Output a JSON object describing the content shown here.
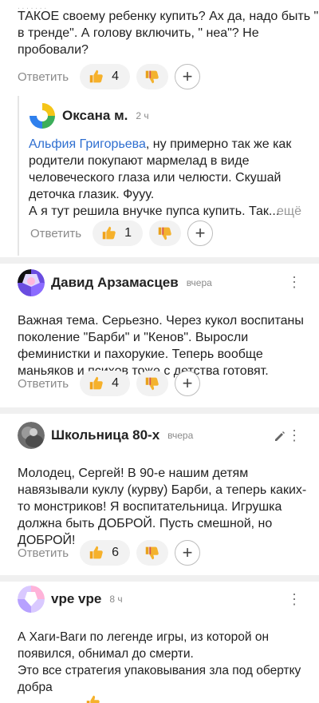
{
  "top_comment": {
    "lines": [
      "ТАКОЕ своему ребенку купить? Ах да, надо быть \"",
      "в тренде\". А голову включить, \" неа\"? Не",
      "пробовали?"
    ],
    "likes": "4"
  },
  "reply": {
    "author": "Оксана м.",
    "time": "2 ч",
    "mention": "Альфия Григорьева",
    "line1_rest": ", ну примерно так же как",
    "lines": [
      "родители покупают мармелад в виде",
      "человеческого глаза или челюсти. Скушай",
      "деточка глазик. Фууу.",
      "А я тут решила внучке пупса купить. Так..."
    ],
    "more": "ещё",
    "likes": "1"
  },
  "comment_david": {
    "author": "Давид Арзамасцев",
    "time": "вчера",
    "lines": [
      "Важная тема. Серьезно. Через кукол воспитаны",
      "поколение \"Барби\" и \"Кенов\". Выросли",
      "феминистки и пахорукие. Теперь вообще",
      "маньяков и психов тоже с детства готовят."
    ],
    "likes": "4"
  },
  "comment_school": {
    "author": "Школьница 80-х",
    "time": "вчера",
    "lines": [
      "Молодец, Сергей! В 90-е нашим детям",
      "навязывали куклу (курву) Барби, а теперь каких-",
      "то монстриков! Я воспитательница. Игрушка",
      "должна быть ДОБРОЙ. Пусть смешной, но",
      "ДОБРОЙ!"
    ],
    "likes": "6"
  },
  "comment_vpe": {
    "author": "vpe vpe",
    "time": "8 ч",
    "lines": [
      "А Хаги-Ваги по легенде игры, из которой он",
      "появился, обнимал до смерти.",
      "Это все стратегия упаковывания зла под обертку",
      "добра"
    ]
  },
  "ui": {
    "reply_label": "Ответить",
    "more_dots": "⋮",
    "plus": "+"
  },
  "colors": {
    "link": "#2f6fd0",
    "muted": "#8a8a8a",
    "pill_bg": "#f2f2f2",
    "separator": "#f0f0f0"
  }
}
